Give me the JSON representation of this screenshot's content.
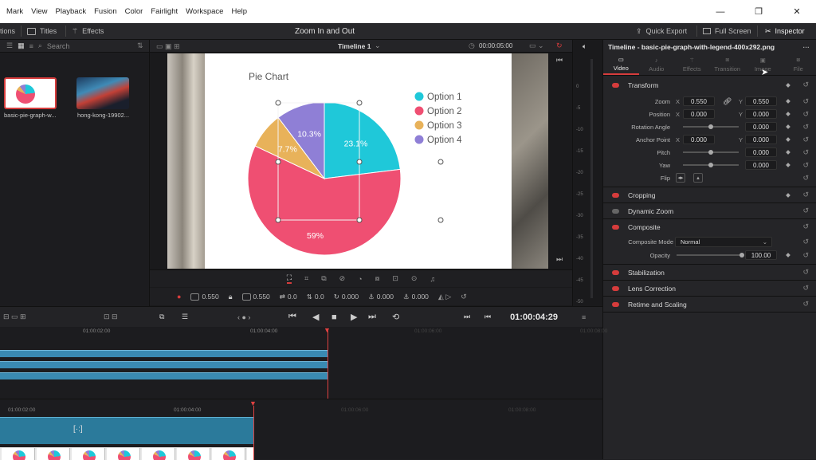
{
  "menu": [
    "Mark",
    "View",
    "Playback",
    "Fusion",
    "Color",
    "Fairlight",
    "Workspace",
    "Help"
  ],
  "window_controls": [
    "—",
    "❐",
    "✕"
  ],
  "toolbar": {
    "left_partial": "tions",
    "titles": "Titles",
    "effects": "Effects",
    "center_title": "Zoom In and Out",
    "quick_export": "Quick Export",
    "full_screen": "Full Screen",
    "inspector": "Inspector"
  },
  "media_pool": {
    "search_placeholder": "Search",
    "clips": [
      {
        "name": "basic-pie-graph-w..."
      },
      {
        "name": "hong-kong-19902..."
      }
    ]
  },
  "viewer": {
    "timeline_name": "Timeline 1",
    "timecode_small": "00:00:05:00",
    "values": {
      "zoom_x": "0.550",
      "zoom_y": "0.550",
      "pos_x": "0.0",
      "pos_y": "0.0",
      "rotation": "0.000",
      "anchor_x": "0.000",
      "anchor_y": "0.000"
    }
  },
  "chart_data": {
    "type": "pie",
    "title": "Pie Chart",
    "categories": [
      "Option 1",
      "Option 2",
      "Option 3",
      "Option 4"
    ],
    "values": [
      23.1,
      59,
      7.7,
      10.3
    ],
    "labels": [
      "23.1%",
      "59%",
      "7.7%",
      "10.3%"
    ],
    "colors": [
      "#1fc8d9",
      "#ef4f72",
      "#e8b25a",
      "#8f7fd6"
    ],
    "legend": "right"
  },
  "meter_scale": [
    "0",
    "-5",
    "-10",
    "-15",
    "-20",
    "-25",
    "-30",
    "-35",
    "-40",
    "-45",
    "-50"
  ],
  "inspector": {
    "title": "Timeline - basic-pie-graph-with-legend-400x292.png",
    "tabs": [
      "Video",
      "Audio",
      "Effects",
      "Transition",
      "Image",
      "File"
    ],
    "transform": {
      "label": "Transform",
      "zoom_label": "Zoom",
      "zoom_x": "0.550",
      "zoom_y": "0.550",
      "position_label": "Position",
      "position_x": "0.000",
      "position_y": "0.000",
      "rotation_label": "Rotation Angle",
      "rotation": "0.000",
      "anchor_label": "Anchor Point",
      "anchor_x": "0.000",
      "anchor_y": "0.000",
      "pitch_label": "Pitch",
      "pitch": "0.000",
      "yaw_label": "Yaw",
      "yaw": "0.000",
      "flip_label": "Flip",
      "x": "X",
      "y": "Y"
    },
    "cropping": "Cropping",
    "dynamic_zoom": "Dynamic Zoom",
    "composite": {
      "label": "Composite",
      "mode_label": "Composite Mode",
      "mode_value": "Normal",
      "opacity_label": "Opacity",
      "opacity_value": "100.00"
    },
    "stabilization": "Stabilization",
    "lens_correction": "Lens Correction",
    "retime": "Retime and Scaling"
  },
  "transport": {
    "timecode": "01:00:04:29"
  },
  "timeline": {
    "upper_ticks": [
      "01:00:02:00",
      "01:00:04:00",
      "01:00:06:00",
      "01:00:08:00"
    ],
    "lower_ticks": [
      "01:00:02:00",
      "01:00:04:00",
      "01:00:06:00",
      "01:00:08:00"
    ]
  }
}
